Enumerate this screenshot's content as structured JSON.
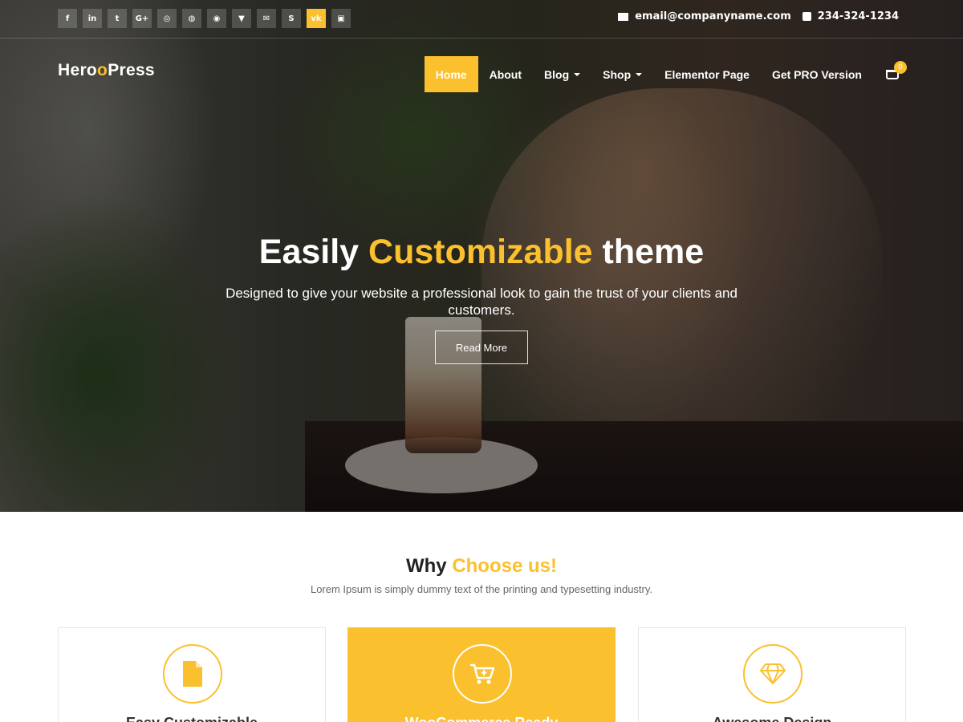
{
  "brand": {
    "logo_part1": "Hero",
    "logo_dot": "o",
    "logo_part2": "Press",
    "accent_color": "#fbc02d"
  },
  "topbar": {
    "socials": [
      {
        "icon": "facebook-icon",
        "glyph": "f",
        "active": false
      },
      {
        "icon": "linkedin-icon",
        "glyph": "in",
        "active": false
      },
      {
        "icon": "twitter-icon",
        "glyph": "t",
        "active": false
      },
      {
        "icon": "google-plus-icon",
        "glyph": "G+",
        "active": false
      },
      {
        "icon": "instagram-icon",
        "glyph": "◎",
        "active": false
      },
      {
        "icon": "dribbble-icon",
        "glyph": "◍",
        "active": false
      },
      {
        "icon": "github-icon",
        "glyph": "◉",
        "active": false
      },
      {
        "icon": "foursquare-icon",
        "glyph": "▼",
        "active": false
      },
      {
        "icon": "email-icon",
        "glyph": "✉",
        "active": false
      },
      {
        "icon": "skype-icon",
        "glyph": "S",
        "active": false
      },
      {
        "icon": "vk-icon",
        "glyph": "vk",
        "active": true
      },
      {
        "icon": "calendar-icon",
        "glyph": "▣",
        "active": false
      }
    ],
    "email": "email@companyname.com",
    "phone": "234-324-1234"
  },
  "nav": {
    "items": [
      {
        "label": "Home",
        "active": true,
        "dropdown": false
      },
      {
        "label": "About",
        "active": false,
        "dropdown": false
      },
      {
        "label": "Blog",
        "active": false,
        "dropdown": true
      },
      {
        "label": "Shop",
        "active": false,
        "dropdown": true
      },
      {
        "label": "Elementor Page",
        "active": false,
        "dropdown": false
      },
      {
        "label": "Get PRO Version",
        "active": false,
        "dropdown": false
      }
    ],
    "cart_count": "0"
  },
  "hero": {
    "title_part1": "Easily ",
    "title_highlight": "Customizable",
    "title_part2": " theme",
    "subtitle": "Designed to give your website a professional look to gain the trust of your clients and customers.",
    "button": "Read More"
  },
  "why": {
    "title_part1": "Why ",
    "title_highlight": "Choose us!",
    "subtitle": "Lorem Ipsum is simply dummy text of the printing and typesetting industry."
  },
  "features": [
    {
      "icon": "document-icon",
      "title": "Easy Customizable"
    },
    {
      "icon": "cart-add-icon",
      "title": "WooCommerce Ready"
    },
    {
      "icon": "diamond-icon",
      "title": "Awesome Design"
    }
  ]
}
